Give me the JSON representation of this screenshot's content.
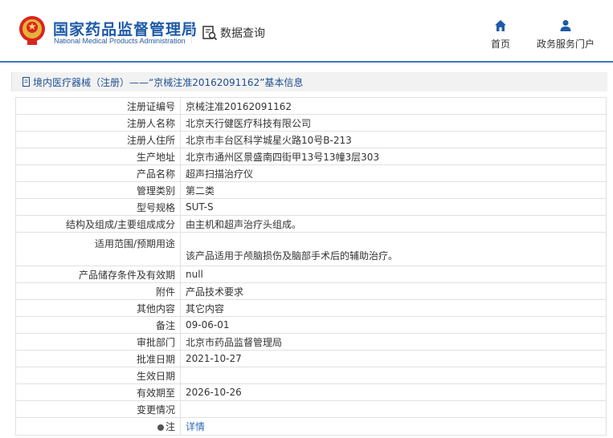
{
  "header": {
    "logo_cn": "国家药品监督管理局",
    "logo_en": "National Medical Products Administration",
    "query_label": "数据查询",
    "nav": [
      {
        "label": "首页",
        "icon": "home-icon"
      },
      {
        "label": "政务服务门户",
        "icon": "user-icon"
      }
    ],
    "brand_color": "#1d5aa8",
    "line_color": "#3a76c3"
  },
  "breadcrumb": {
    "text": "境内医疗器械（注册）——“京械注准20162091162”基本信息"
  },
  "record": {
    "rows": [
      {
        "label": "注册证编号",
        "value": "京械注准20162091162"
      },
      {
        "label": "注册人名称",
        "value": "北京天行健医疗科技有限公司"
      },
      {
        "label": "注册人住所",
        "value": "北京市丰台区科学城星火路10号B-213"
      },
      {
        "label": "生产地址",
        "value": "北京市通州区景盛南四街甲13号13幢3层303"
      },
      {
        "label": "产品名称",
        "value": "超声扫描治疗仪"
      },
      {
        "label": "管理类别",
        "value": "第二类"
      },
      {
        "label": "型号规格",
        "value": "SUT-S"
      },
      {
        "label": "结构及组成/主要组成成分",
        "value": "由主机和超声治疗头组成。"
      },
      {
        "label": "适用范围/预期用途",
        "value": "该产品适用于颅脑损伤及脑部手术后的辅助治疗。"
      },
      {
        "label": "产品储存条件及有效期",
        "value": "null"
      },
      {
        "label": "附件",
        "value": "产品技术要求"
      },
      {
        "label": "其他内容",
        "value": "其它内容"
      },
      {
        "label": "备注",
        "value": "09-06-01"
      },
      {
        "label": "审批部门",
        "value": "北京市药品监督管理局"
      },
      {
        "label": "批准日期",
        "value": "2021-10-27"
      },
      {
        "label": "生效日期",
        "value": ""
      },
      {
        "label": "有效期至",
        "value": "2026-10-26"
      },
      {
        "label": "变更情况",
        "value": ""
      }
    ],
    "note": {
      "label": "注",
      "link": "详情"
    }
  }
}
